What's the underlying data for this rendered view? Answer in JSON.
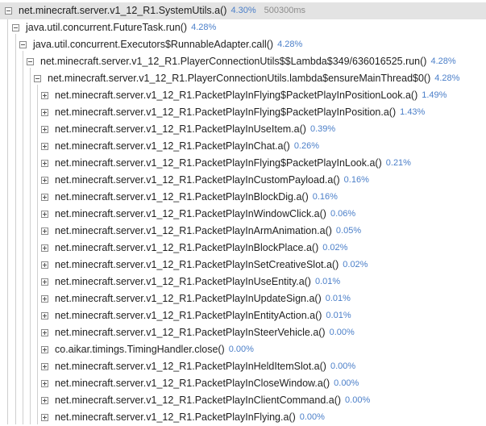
{
  "tree": {
    "root": {
      "name": "net.minecraft.server.v1_12_R1.SystemUtils.a()",
      "percent": "4.30%",
      "time": "500300ms",
      "toggle": "collapse"
    },
    "level1": {
      "name": "java.util.concurrent.FutureTask.run()",
      "percent": "4.28%",
      "toggle": "collapse"
    },
    "level2": {
      "name": "java.util.concurrent.Executors$RunnableAdapter.call()",
      "percent": "4.28%",
      "toggle": "collapse"
    },
    "level3": {
      "name": "net.minecraft.server.v1_12_R1.PlayerConnectionUtils$$Lambda$349/636016525.run()",
      "percent": "4.28%",
      "toggle": "collapse"
    },
    "level4": {
      "name": "net.minecraft.server.v1_12_R1.PlayerConnectionUtils.lambda$ensureMainThread$0()",
      "percent": "4.28%",
      "toggle": "collapse"
    },
    "children": [
      {
        "name": "net.minecraft.server.v1_12_R1.PacketPlayInFlying$PacketPlayInPositionLook.a()",
        "percent": "1.49%",
        "toggle": "expand"
      },
      {
        "name": "net.minecraft.server.v1_12_R1.PacketPlayInFlying$PacketPlayInPosition.a()",
        "percent": "1.43%",
        "toggle": "expand"
      },
      {
        "name": "net.minecraft.server.v1_12_R1.PacketPlayInUseItem.a()",
        "percent": "0.39%",
        "toggle": "expand"
      },
      {
        "name": "net.minecraft.server.v1_12_R1.PacketPlayInChat.a()",
        "percent": "0.26%",
        "toggle": "expand"
      },
      {
        "name": "net.minecraft.server.v1_12_R1.PacketPlayInFlying$PacketPlayInLook.a()",
        "percent": "0.21%",
        "toggle": "expand"
      },
      {
        "name": "net.minecraft.server.v1_12_R1.PacketPlayInCustomPayload.a()",
        "percent": "0.16%",
        "toggle": "expand"
      },
      {
        "name": "net.minecraft.server.v1_12_R1.PacketPlayInBlockDig.a()",
        "percent": "0.16%",
        "toggle": "expand"
      },
      {
        "name": "net.minecraft.server.v1_12_R1.PacketPlayInWindowClick.a()",
        "percent": "0.06%",
        "toggle": "expand"
      },
      {
        "name": "net.minecraft.server.v1_12_R1.PacketPlayInArmAnimation.a()",
        "percent": "0.05%",
        "toggle": "expand"
      },
      {
        "name": "net.minecraft.server.v1_12_R1.PacketPlayInBlockPlace.a()",
        "percent": "0.02%",
        "toggle": "expand"
      },
      {
        "name": "net.minecraft.server.v1_12_R1.PacketPlayInSetCreativeSlot.a()",
        "percent": "0.02%",
        "toggle": "expand"
      },
      {
        "name": "net.minecraft.server.v1_12_R1.PacketPlayInUseEntity.a()",
        "percent": "0.01%",
        "toggle": "expand"
      },
      {
        "name": "net.minecraft.server.v1_12_R1.PacketPlayInUpdateSign.a()",
        "percent": "0.01%",
        "toggle": "expand"
      },
      {
        "name": "net.minecraft.server.v1_12_R1.PacketPlayInEntityAction.a()",
        "percent": "0.01%",
        "toggle": "expand"
      },
      {
        "name": "net.minecraft.server.v1_12_R1.PacketPlayInSteerVehicle.a()",
        "percent": "0.00%",
        "toggle": "expand"
      },
      {
        "name": "co.aikar.timings.TimingHandler.close()",
        "percent": "0.00%",
        "toggle": "expand"
      },
      {
        "name": "net.minecraft.server.v1_12_R1.PacketPlayInHeldItemSlot.a()",
        "percent": "0.00%",
        "toggle": "expand"
      },
      {
        "name": "net.minecraft.server.v1_12_R1.PacketPlayInCloseWindow.a()",
        "percent": "0.00%",
        "toggle": "expand"
      },
      {
        "name": "net.minecraft.server.v1_12_R1.PacketPlayInClientCommand.a()",
        "percent": "0.00%",
        "toggle": "expand"
      },
      {
        "name": "net.minecraft.server.v1_12_R1.PacketPlayInFlying.a()",
        "percent": "0.00%",
        "toggle": "expand"
      }
    ]
  }
}
